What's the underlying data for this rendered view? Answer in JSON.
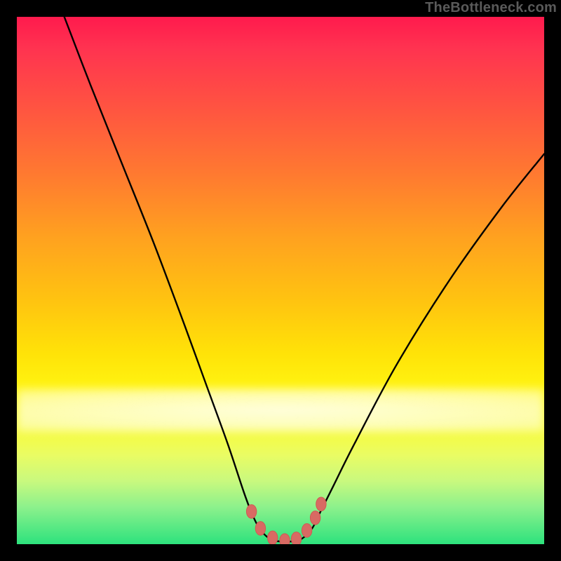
{
  "watermark": "TheBottleneck.com",
  "colors": {
    "frame": "#000000",
    "curve": "#000000",
    "marker_fill": "#d86a63",
    "marker_stroke": "#cf5a52",
    "gradient_top": "#ff1a4d",
    "gradient_bottom": "#2de27d"
  },
  "chart_data": {
    "type": "line",
    "title": "",
    "xlabel": "",
    "ylabel": "",
    "xlim": [
      0,
      100
    ],
    "ylim": [
      0,
      100
    ],
    "grid": false,
    "legend": "none",
    "note": "Bottleneck-style V-curve. Y represents bottleneck severity (0 = no bottleneck near bottom, 100 = severe near top). X is an unlabeled component-ratio axis. Values are estimated from pixel positions; no axis ticks are rendered.",
    "series": [
      {
        "name": "bottleneck-curve",
        "x": [
          9,
          14,
          20,
          26,
          32,
          36,
          40,
          43,
          44.5,
          46,
          48,
          50,
          52,
          54,
          56,
          57.5,
          60,
          64,
          72,
          82,
          92,
          100
        ],
        "y": [
          100,
          87,
          72,
          57,
          41,
          30,
          19,
          10,
          6,
          3,
          1,
          0.5,
          0.5,
          1,
          3,
          6,
          11,
          19,
          34,
          50,
          64,
          74
        ]
      }
    ],
    "markers": {
      "name": "highlight-points",
      "x": [
        44.5,
        46.2,
        48.5,
        50.8,
        53,
        55,
        56.6,
        57.7
      ],
      "y": [
        6.2,
        3.0,
        1.2,
        0.7,
        1.0,
        2.6,
        5.0,
        7.6
      ]
    }
  }
}
